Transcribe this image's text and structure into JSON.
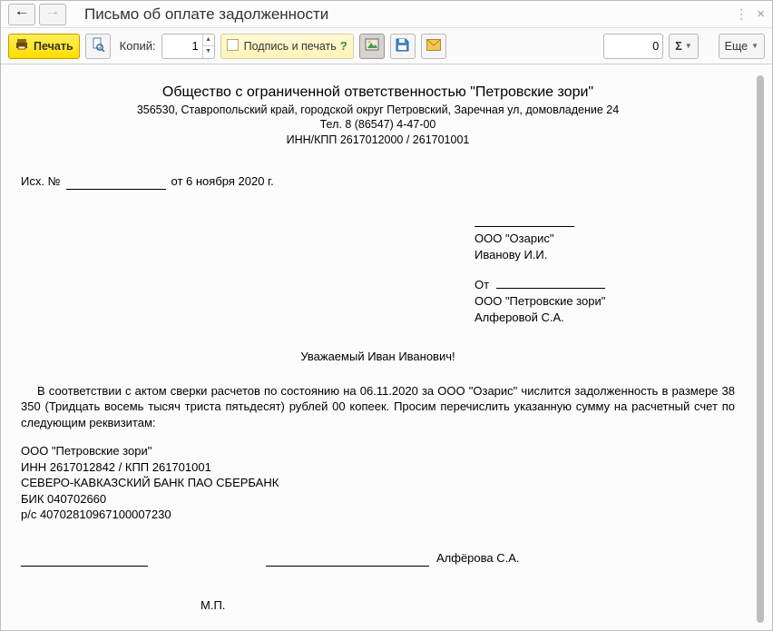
{
  "window_title": "Письмо об оплате задолженности",
  "toolbar": {
    "print_label": "Печать",
    "copies_label": "Копий:",
    "copies_value": "1",
    "sign_print_label": "Подпись и печать",
    "num_value": "0",
    "sigma_label": "Σ",
    "more_label": "Еще"
  },
  "doc": {
    "org_title": "Общество с ограниченной ответственностью \"Петровские зори\"",
    "address": "356530, Ставропольский край, городской округ Петровский, Заречная ул, домовладение 24",
    "phone": "Тел. 8 (86547) 4-47-00",
    "innkpp": "ИНН/КПП 2617012000 / 261701001",
    "out_prefix": "Исх. №",
    "out_date": "от 6 ноября 2020 г.",
    "to_org": "ООО \"Озарис\"",
    "to_person": "Иванову  И.И.",
    "from_label": "От",
    "from_org": "ООО \"Петровские зори\"",
    "from_person": "Алферовой С.А.",
    "greeting": "Уважаемый Иван Иванович!",
    "body": "В соответствии с актом сверки расчетов по состоянию на 06.11.2020 за ООО \"Озарис\" числится задолженность в размере 38 350 (Тридцать восемь тысяч триста пятьдесят) рублей 00 копеек. Просим перечислить указанную сумму на расчетный счет  по следующим реквизитам:",
    "req_org": "ООО \"Петровские зори\"",
    "req_inn": "ИНН 2617012842 / КПП 261701001",
    "req_bank": "СЕВЕРО-КАВКАЗСКИЙ БАНК ПАО СБЕРБАНК",
    "req_bik": "БИК 040702660",
    "req_acc": "р/с 40702810967100007230",
    "signer": "Алфёрова С.А.",
    "mp": "М.П."
  }
}
